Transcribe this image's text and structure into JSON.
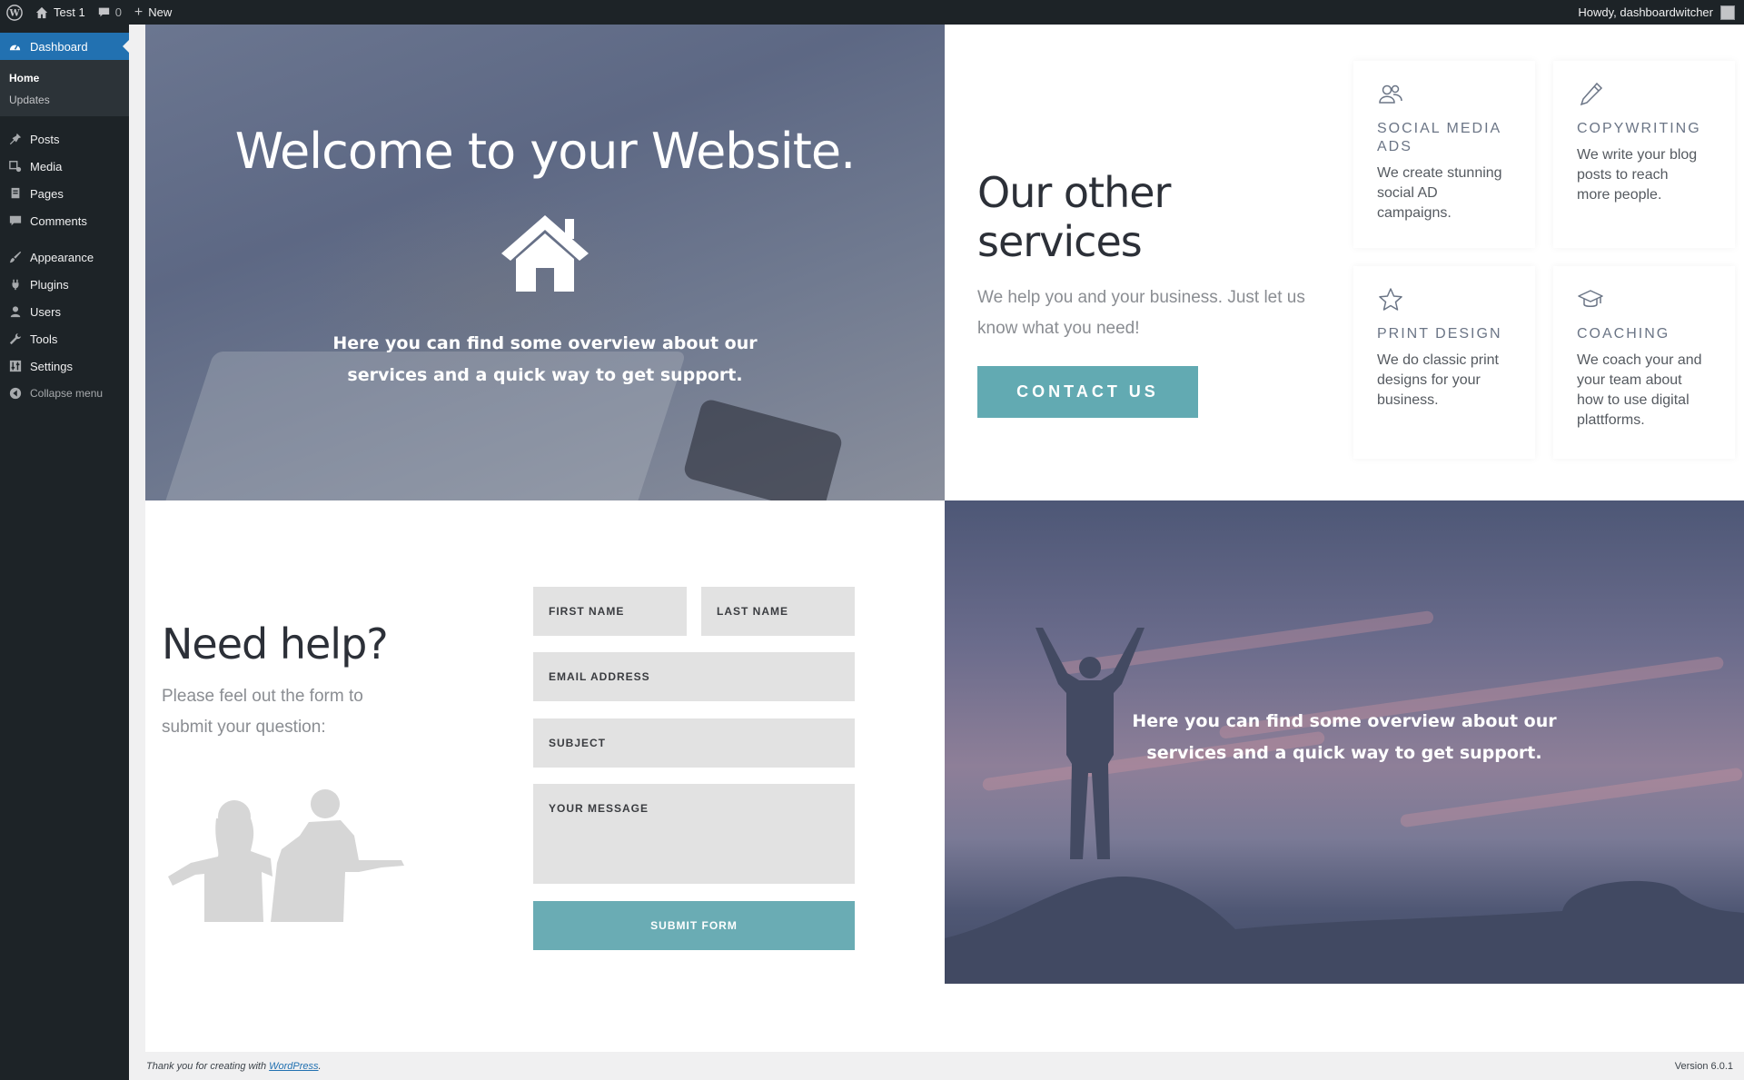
{
  "adminbar": {
    "site_name": "Test 1",
    "comments_count": "0",
    "new_label": "New",
    "howdy": "Howdy, dashboardwitcher"
  },
  "sidebar": {
    "dashboard": "Dashboard",
    "submenu": [
      "Home",
      "Updates"
    ],
    "items": [
      {
        "label": "Posts",
        "icon": "pin-icon"
      },
      {
        "label": "Media",
        "icon": "media-icon"
      },
      {
        "label": "Pages",
        "icon": "pages-icon"
      },
      {
        "label": "Comments",
        "icon": "comments-icon"
      },
      {
        "label": "Appearance",
        "icon": "brush-icon"
      },
      {
        "label": "Plugins",
        "icon": "plugin-icon"
      },
      {
        "label": "Users",
        "icon": "users-icon"
      },
      {
        "label": "Tools",
        "icon": "wrench-icon"
      },
      {
        "label": "Settings",
        "icon": "settings-icon"
      }
    ],
    "collapse": "Collapse menu",
    "accent": "#2271b1"
  },
  "hero": {
    "title": "Welcome to your Website.",
    "text_line1": "Here you can find some overview about our",
    "text_line2": "services and a quick way to get support."
  },
  "services": {
    "title": "Our other services",
    "text_line1": "We help you and your business. Just let us",
    "text_line2": "know what you need!",
    "button": "CONTACT US",
    "cards": [
      {
        "title_line1": "SOCIAL MEDIA",
        "title_line2": "ADS",
        "text": [
          "We create stunning",
          "social AD",
          "campaigns."
        ],
        "icon": "users-icon"
      },
      {
        "title_line1": "COPYWRITING",
        "title_line2": "",
        "text": [
          "We write your blog",
          "posts to reach",
          "more people."
        ],
        "icon": "pencil-icon"
      },
      {
        "title_line1": "PRINT DESIGN",
        "title_line2": "",
        "text": [
          "We do classic print",
          "designs for your",
          "business."
        ],
        "icon": "star-icon"
      },
      {
        "title_line1": "COACHING",
        "title_line2": "",
        "text": [
          "We coach your and",
          "your team about",
          "how to use digital",
          "plattforms."
        ],
        "icon": "graduation-cap-icon"
      }
    ]
  },
  "help": {
    "title": "Need help?",
    "text_line1": "Please feel out the form to",
    "text_line2": "submit your question:"
  },
  "form": {
    "first_name": "FIRST NAME",
    "last_name": "LAST NAME",
    "email": "EMAIL ADDRESS",
    "subject": "SUBJECT",
    "message": "YOUR MESSAGE",
    "submit": "SUBMIT FORM"
  },
  "support": {
    "text_line1": "Here you can find some overview about our",
    "text_line2": "services and a quick way to get support."
  },
  "footer": {
    "thanks": "Thank you for creating with",
    "link": "WordPress",
    "version": "Version 6.0.1"
  }
}
